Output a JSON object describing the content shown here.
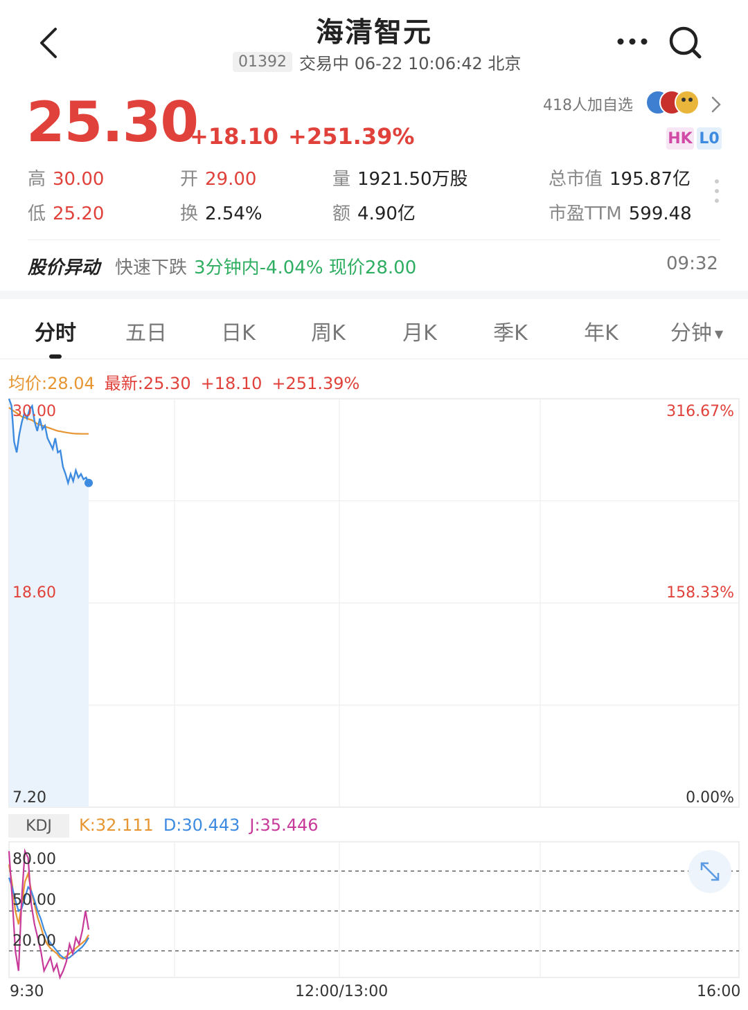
{
  "header": {
    "title": "海清智元",
    "code": "01392",
    "status_line": "交易中 06-22 10:06:42 北京"
  },
  "quote": {
    "price": "25.30",
    "change": "+18.10",
    "change_pct": "+251.39%",
    "followers": "418人加自选",
    "badges": [
      "HK",
      "L0"
    ],
    "stats": {
      "high_label": "高",
      "high": "30.00",
      "low_label": "低",
      "low": "25.20",
      "open_label": "开",
      "open": "29.00",
      "turnover_label": "换",
      "turnover": "2.54%",
      "volume_label": "量",
      "volume": "1921.50万股",
      "amount_label": "额",
      "amount": "4.90亿",
      "mktcap_label": "总市值",
      "mktcap": "195.87亿",
      "pe_label": "市盈TTM",
      "pe": "599.48"
    }
  },
  "alert": {
    "title": "股价异动",
    "desc": "快速下跌",
    "detail": "3分钟内-4.04% 现价28.00",
    "time": "09:32"
  },
  "tabs": [
    {
      "label": "分时",
      "active": true
    },
    {
      "label": "五日"
    },
    {
      "label": "日K"
    },
    {
      "label": "周K"
    },
    {
      "label": "月K"
    },
    {
      "label": "季K"
    },
    {
      "label": "年K"
    },
    {
      "label": "分钟"
    }
  ],
  "chart_info": {
    "avg": "均价:28.04",
    "last": "最新:25.30",
    "change": "+18.10",
    "change_pct": "+251.39%"
  },
  "kdj": {
    "label": "KDJ",
    "k": "K:32.111",
    "d": "D:30.443",
    "j": "J:35.446"
  },
  "chart_data": {
    "type": "line",
    "price_axis": {
      "ticks": [
        "30.00",
        "18.60",
        "7.20"
      ],
      "ylim": [
        7.2,
        30.0
      ]
    },
    "pct_axis": {
      "ticks": [
        "316.67%",
        "158.33%",
        "0.00%"
      ]
    },
    "time_axis": {
      "ticks": [
        "9:30",
        "12:00/13:00",
        "16:00"
      ]
    },
    "series": [
      {
        "name": "price",
        "values": [
          30.0,
          29.6,
          27.6,
          27.0,
          28.0,
          28.7,
          29.2,
          28.9,
          29.4,
          29.6,
          28.7,
          28.2,
          28.9,
          28.3,
          28.5,
          27.8,
          27.5,
          27.2,
          27.8,
          27.0,
          27.1,
          26.2,
          25.8,
          25.3,
          25.8,
          25.4,
          26.0,
          25.6,
          25.8,
          25.5,
          25.6,
          25.3
        ]
      },
      {
        "name": "average",
        "values": [
          29.5,
          29.4,
          29.3,
          29.2,
          29.1,
          29.0,
          28.95,
          28.9,
          28.85,
          28.8,
          28.7,
          28.6,
          28.55,
          28.5,
          28.45,
          28.4,
          28.35,
          28.3,
          28.25,
          28.2,
          28.18,
          28.15,
          28.12,
          28.1,
          28.08,
          28.06,
          28.05,
          28.05,
          28.04,
          28.04,
          28.04,
          28.04
        ]
      }
    ],
    "kdj_chart": {
      "ticks": [
        "80.00",
        "50.00",
        "20.00"
      ],
      "ylim": [
        0,
        100
      ],
      "series": [
        {
          "name": "K",
          "values": [
            85,
            70,
            50,
            40,
            55,
            72,
            78,
            65,
            55,
            45,
            38,
            30,
            25,
            22,
            20,
            18,
            15,
            14,
            16,
            18,
            20,
            22,
            24,
            26,
            28,
            32
          ]
        },
        {
          "name": "D",
          "values": [
            75,
            68,
            58,
            50,
            52,
            60,
            68,
            65,
            58,
            50,
            44,
            36,
            30,
            26,
            23,
            20,
            17,
            15,
            14,
            15,
            17,
            19,
            21,
            23,
            26,
            30
          ]
        },
        {
          "name": "J",
          "values": [
            95,
            60,
            20,
            5,
            60,
            95,
            90,
            55,
            40,
            30,
            20,
            5,
            10,
            15,
            5,
            10,
            0,
            5,
            12,
            25,
            18,
            30,
            25,
            35,
            50,
            36
          ]
        }
      ]
    }
  }
}
